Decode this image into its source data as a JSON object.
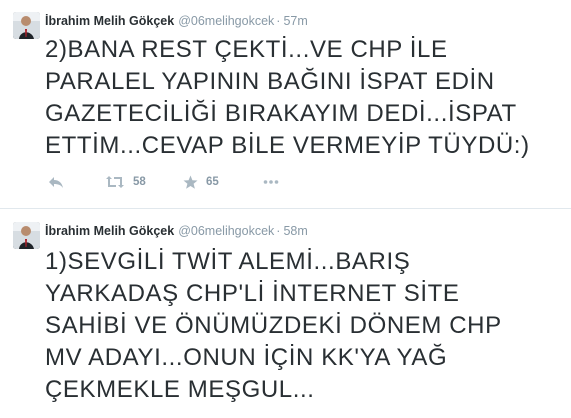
{
  "colors": {
    "text": "#292f33",
    "muted": "#8899a6",
    "icon": "#aab8c2",
    "divider": "#e1e8ed"
  },
  "tweets": [
    {
      "fullname": "İbrahim Melih Gökçek",
      "username": "@06melihgokcek",
      "separator": "·",
      "time": "57m",
      "text": "2)BANA REST ÇEKTİ...VE CHP İLE\nPARALEL YAPININ BAĞINI İSPAT EDİN\nGAZETECİLİĞİ BIRAKAYIM DEDİ...İSPAT\nETTİM...CEVAP BİLE VERMEYİP TÜYDÜ:)",
      "actions": {
        "reply_icon": "reply-icon",
        "retweet_icon": "retweet-icon",
        "retweet_count": "58",
        "favorite_icon": "star-icon",
        "favorite_count": "65",
        "more_icon": "more-icon"
      }
    },
    {
      "fullname": "İbrahim Melih Gökçek",
      "username": "@06melihgokcek",
      "separator": "·",
      "time": "58m",
      "text": "1)SEVGİLİ TWİT ALEMİ...BARIŞ\nYARKADAŞ CHP'Lİ İNTERNET SİTE\nSAHİBİ VE ÖNÜMÜZDEKİ DÖNEM CHP\nMV ADAYI...ONUN İÇİN KK'YA YAĞ\nÇEKMEKLE MEŞGUL..."
    }
  ]
}
